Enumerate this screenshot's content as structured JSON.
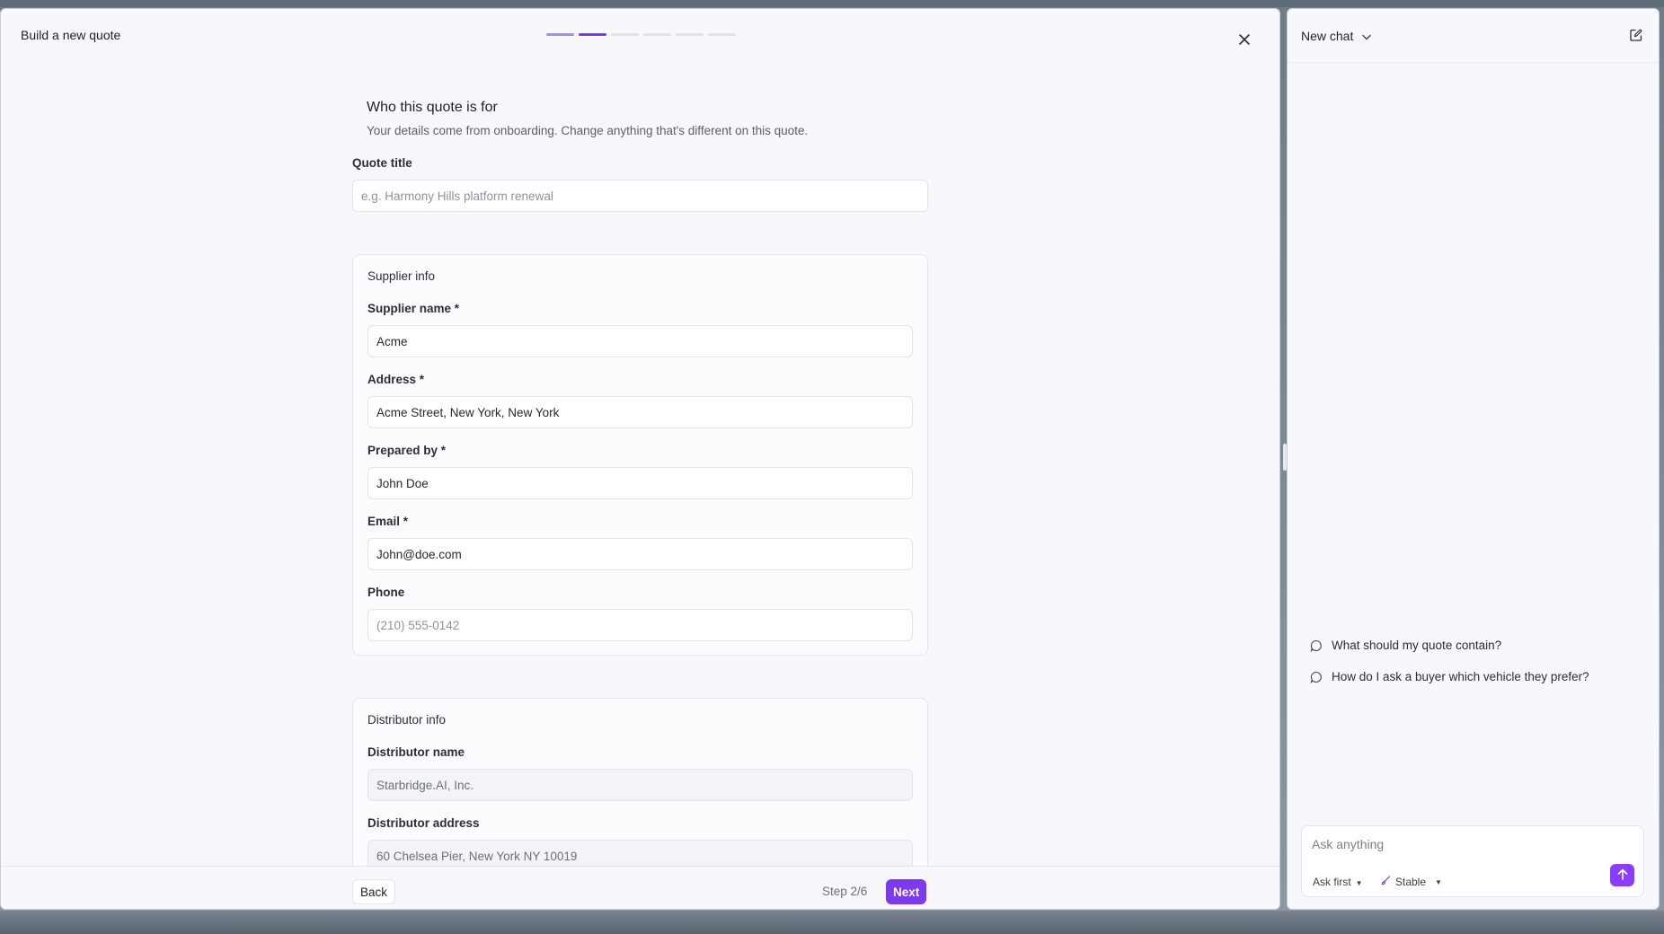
{
  "dialog": {
    "title": "Build a new quote",
    "steps_total": 6,
    "current_step": 2
  },
  "section": {
    "title": "Who this quote is for",
    "subtitle": "Your details come from onboarding. Change anything that's different on this quote."
  },
  "quote_title": {
    "label": "Quote title",
    "value": "",
    "placeholder": "e.g. Harmony Hills platform renewal"
  },
  "supplier": {
    "title": "Supplier info",
    "name_label": "Supplier name *",
    "name_value": "Acme",
    "address_label": "Address *",
    "address_value": "Acme Street, New York, New York",
    "prepared_label": "Prepared by *",
    "prepared_value": "John Doe",
    "email_label": "Email *",
    "email_value": "John@doe.com",
    "phone_label": "Phone",
    "phone_value": "",
    "phone_placeholder": "(210) 555-0142"
  },
  "distributor": {
    "title": "Distributor info",
    "name_label": "Distributor name",
    "name_value": "Starbridge.AI, Inc.",
    "address_label": "Distributor address",
    "address_value": "60 Chelsea Pier, New York NY 10019"
  },
  "footer": {
    "back_label": "Back",
    "step_text": "Step 2/6",
    "next_label": "Next"
  },
  "chat": {
    "title": "New chat",
    "suggestions": [
      "What should my quote contain?",
      "How do I ask a buyer which vehicle they prefer?"
    ],
    "input_placeholder": "Ask anything",
    "mode_label": "Ask first",
    "model_label": "Stable"
  },
  "colors": {
    "accent": "#7c3aed",
    "accent_light": "#a78bfa",
    "send_button": "#8b3dff"
  },
  "icons": {
    "close": "close-icon",
    "new_chat": "compose-icon",
    "suggestion": "chat-bubble-icon",
    "send": "arrow-up-icon",
    "model": "brush-icon"
  }
}
